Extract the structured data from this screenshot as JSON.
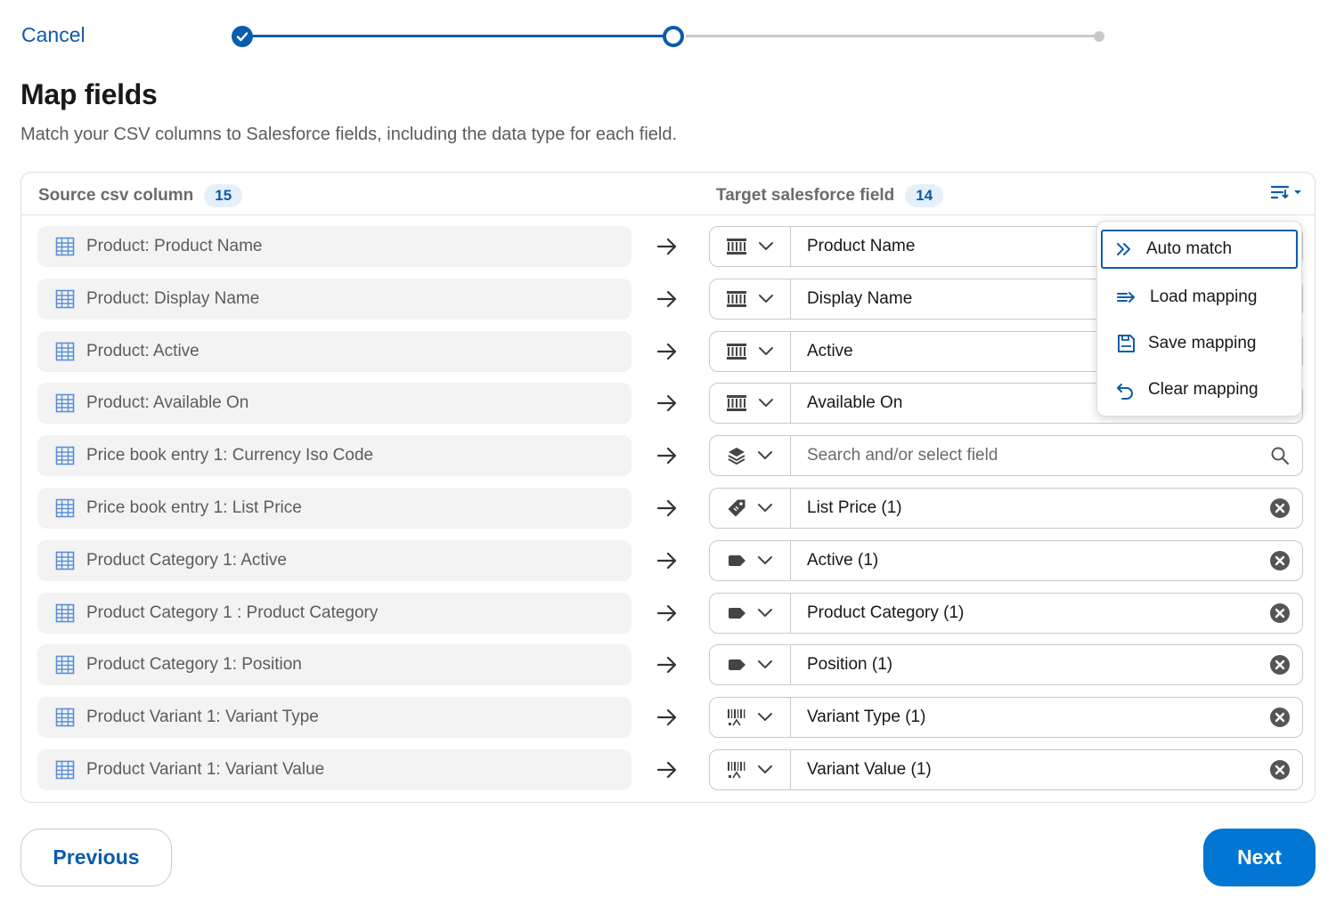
{
  "header": {
    "cancel_label": "Cancel"
  },
  "page": {
    "title": "Map fields",
    "subtitle": "Match your CSV columns to Salesforce fields, including the data type for each field."
  },
  "table": {
    "source_header": "Source csv column",
    "source_count": "15",
    "target_header": "Target salesforce field",
    "target_count": "14",
    "rows": [
      {
        "source": "Product: Product Name",
        "type_icon": "text-type-icon",
        "target": "Product Name",
        "placeholder": false,
        "end_icon": "none"
      },
      {
        "source": "Product: Display Name",
        "type_icon": "text-type-icon",
        "target": "Display Name",
        "placeholder": false,
        "end_icon": "none"
      },
      {
        "source": "Product: Active",
        "type_icon": "text-type-icon",
        "target": "Active",
        "placeholder": false,
        "end_icon": "none"
      },
      {
        "source": "Product: Available On",
        "type_icon": "text-type-icon",
        "target": "Available On",
        "placeholder": false,
        "end_icon": "none"
      },
      {
        "source": "Price book entry 1: Currency Iso Code",
        "type_icon": "layers-icon",
        "target": "Search and/or select field",
        "placeholder": true,
        "end_icon": "search-icon"
      },
      {
        "source": "Price book entry 1: List Price",
        "type_icon": "price-tag-icon",
        "target": "List Price (1)",
        "placeholder": false,
        "end_icon": "clear-icon"
      },
      {
        "source": "Product Category 1: Active",
        "type_icon": "label-tag-icon",
        "target": "Active (1)",
        "placeholder": false,
        "end_icon": "clear-icon"
      },
      {
        "source": "Product Category 1 : Product Category",
        "type_icon": "label-tag-icon",
        "target": "Product Category (1)",
        "placeholder": false,
        "end_icon": "clear-icon"
      },
      {
        "source": "Product Category 1: Position",
        "type_icon": "label-tag-icon",
        "target": "Position (1)",
        "placeholder": false,
        "end_icon": "clear-icon"
      },
      {
        "source": "Product Variant 1: Variant Type",
        "type_icon": "barcode-icon",
        "target": "Variant Type (1)",
        "placeholder": false,
        "end_icon": "clear-icon"
      },
      {
        "source": "Product Variant 1: Variant Value",
        "type_icon": "barcode-icon",
        "target": "Variant Value (1)",
        "placeholder": false,
        "end_icon": "clear-icon"
      }
    ]
  },
  "menu": {
    "items": [
      {
        "label": "Auto match",
        "icon": "double-chevron-right-icon"
      },
      {
        "label": "Load mapping",
        "icon": "load-arrow-icon"
      },
      {
        "label": "Save mapping",
        "icon": "save-icon"
      },
      {
        "label": "Clear mapping",
        "icon": "undo-icon"
      }
    ]
  },
  "footer": {
    "previous_label": "Previous",
    "next_label": "Next"
  },
  "colors": {
    "brand": "#0b5cab",
    "button_primary": "#0176d3",
    "border": "#c9c9c9",
    "source_bg": "#f3f3f3"
  }
}
